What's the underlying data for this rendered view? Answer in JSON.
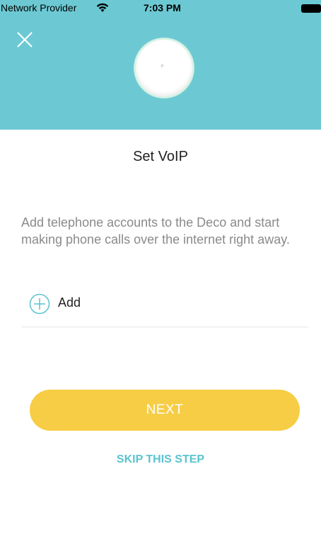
{
  "status_bar": {
    "carrier": "Network Provider",
    "time": "7:03 PM",
    "wifi_icon": "wifi-icon",
    "battery_icon": "battery-icon"
  },
  "header": {
    "close_icon": "close-icon",
    "device_image": "deco-device",
    "background_color": "#6cc9d3"
  },
  "main": {
    "title": "Set VoIP",
    "description": "Add telephone accounts to the Deco and start making phone calls over the internet right away.",
    "add_label": "Add",
    "add_icon": "plus-circle-icon"
  },
  "actions": {
    "next_label": "NEXT",
    "skip_label": "SKIP THIS STEP",
    "next_color": "#f6cd45",
    "skip_color": "#5bc3cf"
  }
}
